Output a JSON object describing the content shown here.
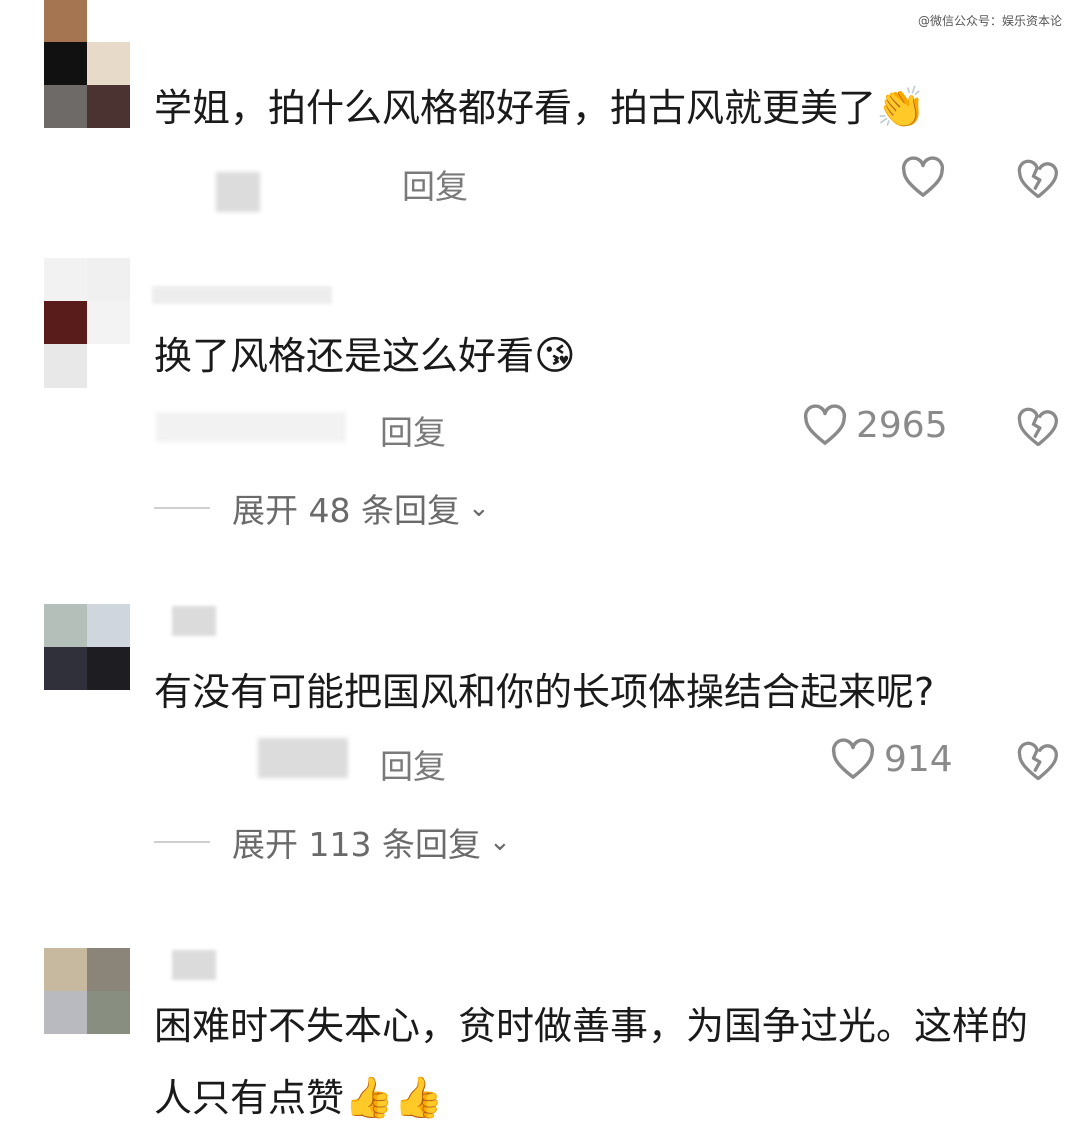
{
  "watermark": "@微信公众号：娱乐资本论",
  "comments": [
    {
      "text": "学姐，拍什么风格都好看，拍古风就更美了",
      "emoji": "👏",
      "reply_label": "回复",
      "likes": "",
      "avatar_colors": [
        "#a47550",
        "#d8c8b4",
        "#111111",
        "#e8dac8",
        "#6e6a68",
        "#4a3330"
      ]
    },
    {
      "text": "换了风格还是这么好看",
      "emoji": "😘",
      "reply_label": "回复",
      "likes": "2965",
      "expand_label": "展开 48 条回复",
      "avatar_colors": [
        "#f2f2f2",
        "#f0f0f0",
        "#5a1c1a",
        "#f3f3f3",
        "#e8e8e8",
        "#ffffff"
      ]
    },
    {
      "text": "有没有可能把国风和你的长项体操结合起来呢?",
      "emoji": "",
      "reply_label": "回复",
      "likes": "914",
      "expand_label": "展开 113 条回复",
      "avatar_colors": [
        "#b4bfba",
        "#cfd6dd",
        "#30303a",
        "#1d1d22"
      ]
    },
    {
      "text": "困难时不失本心，贫时做善事，为国争过光。这样的人只有点赞",
      "emoji": "👍👍",
      "reply_label": "",
      "likes": "",
      "avatar_colors": [
        "#c7b9a0",
        "#8a8578",
        "#b8bac0",
        "#888f80"
      ]
    }
  ],
  "icons": {
    "like": "heart-outline-icon",
    "dislike": "broken-heart-icon",
    "expand": "chevron-down-icon"
  }
}
